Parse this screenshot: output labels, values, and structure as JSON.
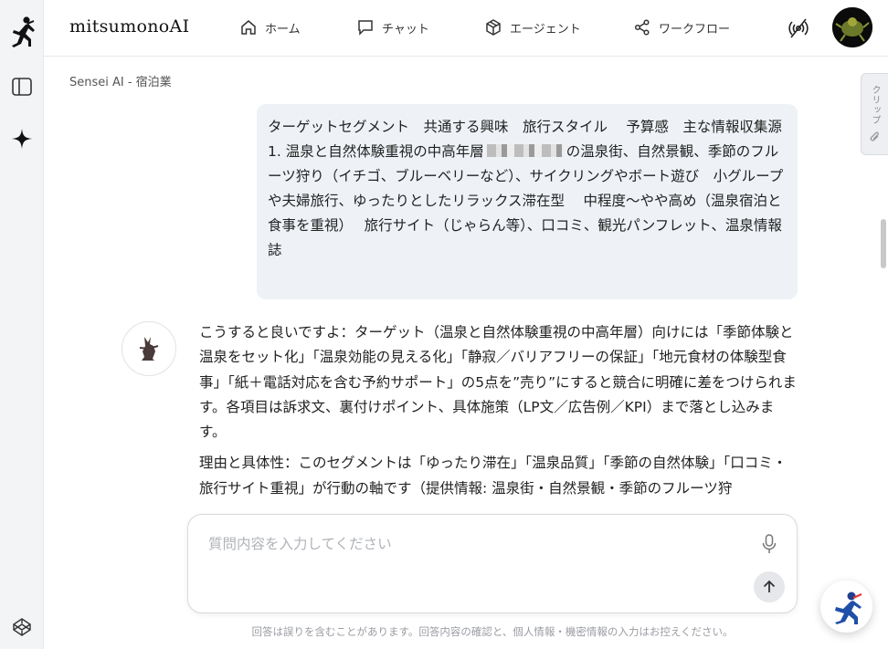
{
  "app": {
    "brand": "mitsumonoAI"
  },
  "nav": [
    {
      "label": "ホーム",
      "icon": "home-icon"
    },
    {
      "label": "チャット",
      "icon": "chat-icon"
    },
    {
      "label": "エージェント",
      "icon": "cube-icon"
    },
    {
      "label": "ワークフロー",
      "icon": "share-nodes-icon"
    }
  ],
  "breadcrumb": "Sensei AI - 宿泊業",
  "clip_tab": {
    "label": "クリップ"
  },
  "user_message": {
    "line1": "ターゲットセグメント　共通する興味　旅行スタイル　 予算感　主な情報収集源",
    "line2_a": "1. 温泉と自然体験重視の中高年層",
    "line2_b": "の温泉街、自然景観、季節のフルーツ狩り（イチゴ、ブルーベリーなど）、サイクリングやボート遊び　小グループや夫婦旅行、ゆったりとしたリラックス滞在型　 中程度〜やや高め（温泉宿泊と食事を重視）　 旅行サイト（じゃらん等）、口コミ、観光パンフレット、温泉情報誌"
  },
  "assistant_message": {
    "p1": "こうすると良いですよ：ターゲット（温泉と自然体験重視の中高年層）向けには「季節体験と温泉をセット化」「温泉効能の見える化」「静寂／バリアフリーの保証」「地元食材の体験型食事」「紙＋電話対応を含む予約サポート」の5点を”売り”にすると競合に明確に差をつけられます。各項目は訴求文、裏付けポイント、具体施策（LP文／広告例／KPI）まで落とし込みます。",
    "p2": "理由と具体性：このセグメントは「ゆったり滞在」「温泉品質」「季節の自然体験」「口コミ・旅行サイト重視」が行動の軸です（提供情報: 温泉街・自然景観・季節のフルーツ狩"
  },
  "input": {
    "placeholder": "質問内容を入力してください",
    "value": ""
  },
  "disclaimer": "回答は誤りを含むことがあります。回答内容の確認と、個人情報・機密情報の入力はお控えください。",
  "colors": {
    "accent": "#1f4fa8",
    "bubble": "#eef2f7",
    "rail": "#f3f4f6"
  }
}
